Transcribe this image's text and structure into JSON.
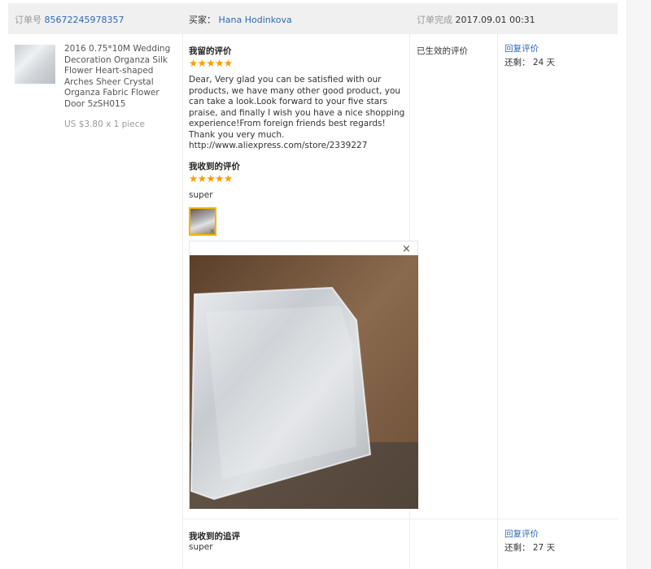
{
  "order": {
    "number_label": "订单号",
    "number": "85672245978357",
    "buyer_label": "买家：",
    "buyer": "Hana Hodinkova",
    "completed_label": "订单完成",
    "completed_time": "2017.09.01 00:31"
  },
  "product": {
    "title": "2016 0.75*10M Wedding Decoration Organza Silk Flower Heart-shaped Arches Sheer Crystal Organza Fabric Flower Door 5zSH015",
    "price": "US $3.80 x 1 piece"
  },
  "my_review": {
    "title": "我留的评价",
    "stars": "★★★★★",
    "text": "Dear, Very glad you can be satisfied with our products, we have many other good product, you can take a look.Look forward to your five stars praise, and finally I wish you have a nice shopping experience!From foreign friends best regards! Thank you very much.",
    "url": "http://www.aliexpress.com/store/2339227"
  },
  "received_review": {
    "title": "我收到的评价",
    "stars": "★★★★★",
    "text": "super"
  },
  "status": "已生效的评价",
  "actions1": {
    "reply": "回复评价",
    "remaining": "还剩： 24 天"
  },
  "followup": {
    "title": "我收到的追评",
    "text": "super",
    "reply": "回复评价",
    "remaining": "还剩： 27 天"
  },
  "popup": {
    "close": "×"
  },
  "colors": {
    "link": "#2b6bb4",
    "star": "#ff9900",
    "highlight": "#f5b400"
  }
}
